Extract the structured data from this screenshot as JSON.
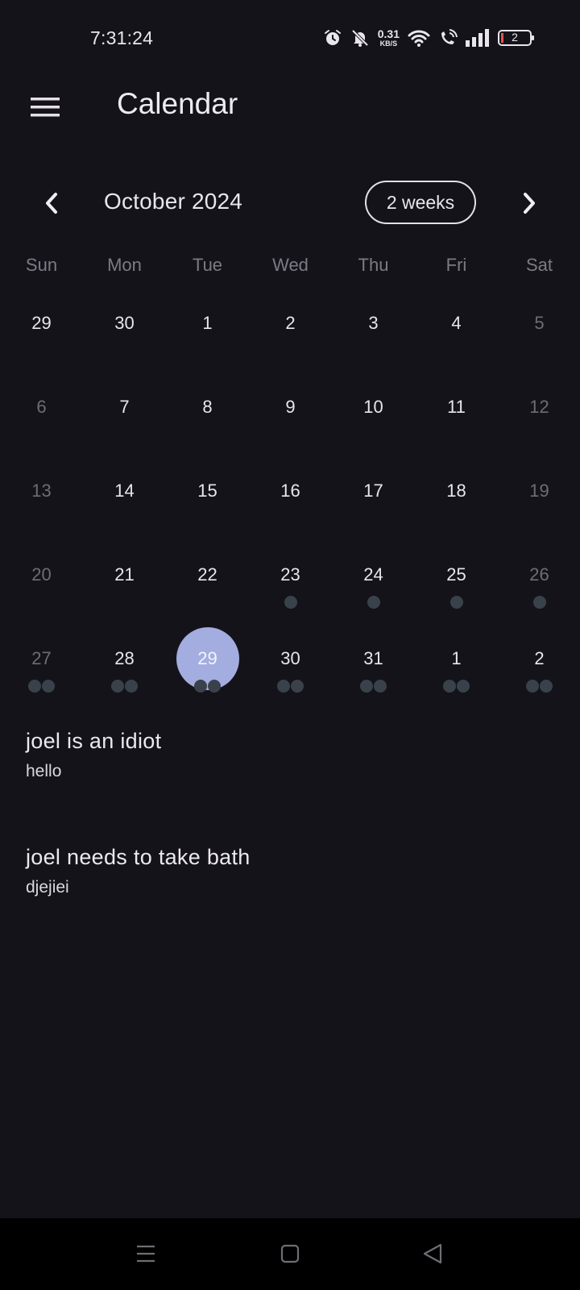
{
  "status_bar": {
    "time": "7:31:24",
    "net_speed_value": "0.31",
    "net_speed_unit": "KB/S",
    "battery_level": "2",
    "icons": [
      "alarm-icon",
      "bell-muted-icon",
      "wifi-icon",
      "wifi-calling-icon",
      "signal-icon",
      "battery-icon"
    ]
  },
  "app_bar": {
    "title": "Calendar",
    "menu_icon": "hamburger-menu-icon"
  },
  "calendar": {
    "month_title": "October 2024",
    "format_button": "2 weeks",
    "prev_icon": "chevron-left-icon",
    "next_icon": "chevron-right-icon",
    "weekdays": [
      "Sun",
      "Mon",
      "Tue",
      "Wed",
      "Thu",
      "Fri",
      "Sat"
    ],
    "weeks": [
      [
        {
          "d": "29",
          "muted": false,
          "markers": 0
        },
        {
          "d": "30",
          "muted": false,
          "markers": 0
        },
        {
          "d": "1",
          "muted": false,
          "markers": 0
        },
        {
          "d": "2",
          "muted": false,
          "markers": 0
        },
        {
          "d": "3",
          "muted": false,
          "markers": 0
        },
        {
          "d": "4",
          "muted": false,
          "markers": 0
        },
        {
          "d": "5",
          "muted": true,
          "markers": 0
        }
      ],
      [
        {
          "d": "6",
          "muted": true,
          "markers": 0
        },
        {
          "d": "7",
          "muted": false,
          "markers": 0
        },
        {
          "d": "8",
          "muted": false,
          "markers": 0
        },
        {
          "d": "9",
          "muted": false,
          "markers": 0
        },
        {
          "d": "10",
          "muted": false,
          "markers": 0
        },
        {
          "d": "11",
          "muted": false,
          "markers": 0
        },
        {
          "d": "12",
          "muted": true,
          "markers": 0
        }
      ],
      [
        {
          "d": "13",
          "muted": true,
          "markers": 0
        },
        {
          "d": "14",
          "muted": false,
          "markers": 0
        },
        {
          "d": "15",
          "muted": false,
          "markers": 0
        },
        {
          "d": "16",
          "muted": false,
          "markers": 0
        },
        {
          "d": "17",
          "muted": false,
          "markers": 0
        },
        {
          "d": "18",
          "muted": false,
          "markers": 0
        },
        {
          "d": "19",
          "muted": true,
          "markers": 0
        }
      ],
      [
        {
          "d": "20",
          "muted": true,
          "markers": 0
        },
        {
          "d": "21",
          "muted": false,
          "markers": 0
        },
        {
          "d": "22",
          "muted": false,
          "markers": 0
        },
        {
          "d": "23",
          "muted": false,
          "markers": 1
        },
        {
          "d": "24",
          "muted": false,
          "markers": 1
        },
        {
          "d": "25",
          "muted": false,
          "markers": 1
        },
        {
          "d": "26",
          "muted": true,
          "markers": 1
        }
      ],
      [
        {
          "d": "27",
          "muted": true,
          "markers": 2
        },
        {
          "d": "28",
          "muted": false,
          "markers": 2
        },
        {
          "d": "29",
          "muted": false,
          "markers": 2,
          "selected": true
        },
        {
          "d": "30",
          "muted": false,
          "markers": 2
        },
        {
          "d": "31",
          "muted": false,
          "markers": 2
        },
        {
          "d": "1",
          "muted": false,
          "markers": 2
        },
        {
          "d": "2",
          "muted": false,
          "markers": 2
        }
      ]
    ],
    "colors": {
      "selected": "#a3ade0",
      "marker": "#39424a",
      "muted_text": "#6e6c75"
    }
  },
  "events": [
    {
      "title": "joel is an idiot",
      "description": "hello"
    },
    {
      "title": "joel needs to take bath",
      "description": "djejiei"
    }
  ],
  "nav_bar": {
    "buttons": [
      "recents-icon",
      "home-icon",
      "back-icon"
    ]
  }
}
